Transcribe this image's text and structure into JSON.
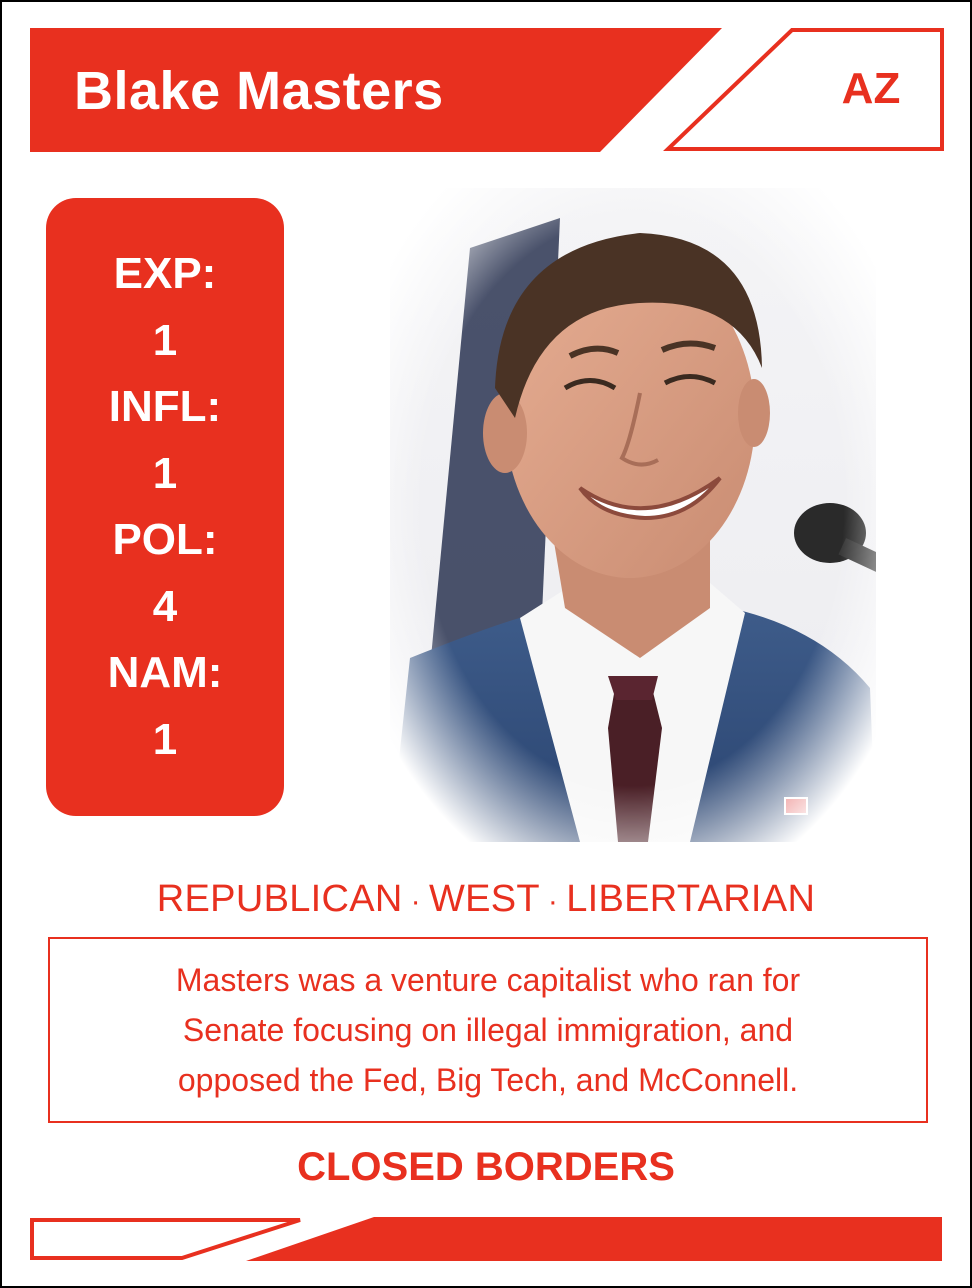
{
  "card": {
    "name": "Blake Masters",
    "state": "AZ",
    "stats": {
      "exp_label": "EXP:",
      "exp_value": "1",
      "infl_label": "INFL:",
      "infl_value": "1",
      "pol_label": "POL:",
      "pol_value": "4",
      "nam_label": "NAM:",
      "nam_value": "1"
    },
    "tags": [
      "REPUBLICAN",
      "WEST",
      "LIBERTARIAN"
    ],
    "tag_separator": "·",
    "description_lines": [
      "Masters was a venture capitalist who ran for",
      "Senate focusing on illegal immigration, and",
      "opposed the Fed, Big Tech, and McConnell."
    ],
    "ability": "CLOSED BORDERS"
  },
  "colors": {
    "accent": "#e8301f",
    "background": "#ffffff",
    "border": "#000000"
  },
  "icons": {
    "portrait": "smiling-man-in-suit-photo"
  }
}
